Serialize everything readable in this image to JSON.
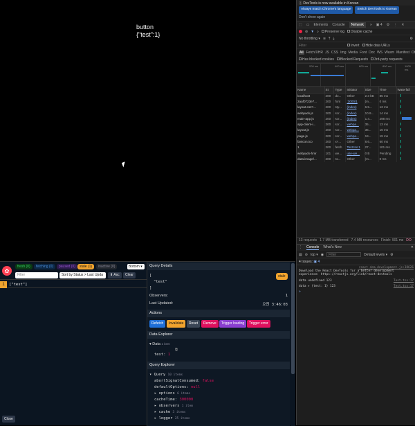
{
  "app": {
    "button_text": "button",
    "json_text": "{\"test\":1}"
  },
  "devtools": {
    "info_bar": "DevTools is now available in Korean",
    "btn_match_language": "Always match Chrome's language",
    "btn_switch_korean": "Switch DevTools to Korean",
    "dont_show": "Don't show again",
    "tabs": [
      "Elements",
      "Console",
      "Network"
    ],
    "active_tab": "Network",
    "issues_count_tab": "4",
    "preserve_log": "Preserve log",
    "disable_cache": "Disable cache",
    "throttling": "No throttling",
    "filter_placeholder": "Filter",
    "invert": "Invert",
    "hide_data_urls": "Hide data URLs",
    "type_filters": [
      "All",
      "Fetch/XHR",
      "JS",
      "CSS",
      "Img",
      "Media",
      "Font",
      "Doc",
      "WS",
      "Wasm",
      "Manifest",
      "Oth"
    ],
    "has_blocked_cookies": "Has blocked cookies",
    "blocked_requests": "Blocked Requests",
    "third_party": "3rd-party requests",
    "timeline_ticks": [
      "200 ms",
      "400 ms",
      "600 ms",
      "800 ms",
      "1000 ms"
    ],
    "columns": [
      "Name",
      "St",
      "Type",
      "Initiator",
      "Size",
      "Time",
      "Waterfall"
    ],
    "requests": [
      {
        "name": "localhost",
        "st": "200",
        "type": "do...",
        "init": "Other",
        "size": "2.3 kB",
        "time": "85 ms"
      },
      {
        "name": "2aaf0723e7...",
        "st": "200",
        "type": "font",
        "init": ":3000/1",
        "size": "(m...",
        "time": "0 ms"
      },
      {
        "name": "layout.css?...",
        "st": "200",
        "type": "sty...",
        "init": "(index)",
        "size": "6.5...",
        "time": "13 ms"
      },
      {
        "name": "webpack.js",
        "st": "200",
        "type": "scr...",
        "init": "(index)",
        "size": "10.9...",
        "time": "14 ms"
      },
      {
        "name": "main-app.js",
        "st": "200",
        "type": "scr...",
        "init": "(index)",
        "size": "1.4...",
        "time": "298 ms"
      },
      {
        "name": "app-client-i...",
        "st": "200",
        "type": "scr...",
        "init": "webpa...",
        "size": "35...",
        "time": "13 ms"
      },
      {
        "name": "layout.js",
        "st": "200",
        "type": "scr...",
        "init": "webpa...",
        "size": "36...",
        "time": "16 ms"
      },
      {
        "name": "page.js",
        "st": "200",
        "type": "scr...",
        "init": "webpa...",
        "size": "19...",
        "time": "19 ms"
      },
      {
        "name": "favicon.ico",
        "st": "200",
        "type": "x-i...",
        "init": "Other",
        "size": "8.6...",
        "time": "60 ms"
      },
      {
        "name": "1",
        "st": "200",
        "type": "fetch",
        "init": "Test.tsx:1",
        "size": "27...",
        "time": "101 ms"
      },
      {
        "name": "webpack-hmr",
        "st": "101",
        "type": "we...",
        "init": "use-we...",
        "size": "0 B",
        "time": "Pending"
      },
      {
        "name": "data:image/...",
        "st": "200",
        "type": "sv...",
        "init": "Other",
        "size": "(m...",
        "time": "0 ms"
      }
    ],
    "status_requests": "13 requests",
    "status_transferred": "1.7 MB transferred",
    "status_resources": "7.4 MB resources",
    "status_finish": "Finish: 901 ms",
    "status_more": "DO",
    "console_tabs": [
      "Console",
      "What's New"
    ],
    "console_context": "top",
    "console_filter": "Filter",
    "default_levels": "Default levels",
    "issues_label": "4 Issues:",
    "issues_count": "4",
    "log_src_react": "react-dom.development.js:38626",
    "log_react_msg_1": "Download the React DevTools for a better development",
    "log_react_msg_2": "experience: https://reactjs.org/link/react-devtools",
    "log_data_undefined": "data undefined 123",
    "log_src_test": "Test.tsx:17",
    "log_data_obj": "data ▸ {test: 1} 123",
    "log_src_test2": "Test.tsx:17",
    "prompt": ">"
  },
  "rq": {
    "pills": {
      "fresh": "fresh (0)",
      "fetching": "fetching (0)",
      "paused": "paused (0)",
      "stale": "stale (1)",
      "inactive": "inactive (0)"
    },
    "position": "Bottom",
    "filter_placeholder": "Filter",
    "sort": "Sort by Status > Last Upda",
    "asc": "⬆ Asc",
    "clear": "Clear",
    "query_count": "1",
    "query_key": "[\"test\"]",
    "close": "Close",
    "details_title": "Query Details",
    "key_lines": [
      "[",
      "\"test\"",
      "]"
    ],
    "stale_badge": "stale",
    "observers_label": "Observers:",
    "observers_value": "1",
    "last_updated_label": "Last Updated:",
    "last_updated_value": "오전 3:46:03",
    "actions_title": "Actions",
    "actions": [
      "Refetch",
      "Invalidate",
      "Reset",
      "Remove",
      "Trigger loading",
      "Trigger error"
    ],
    "data_explorer_title": "Data Explorer",
    "data_label": "▾ Data",
    "data_count": "1 item",
    "data_key": "test:",
    "data_value": "1",
    "query_explorer_title": "Query Explorer",
    "query_label": "▾ Query",
    "query_count_items": "10 items",
    "q_abort_key": "abortSignalConsumed:",
    "q_abort_val": "false",
    "q_default_key": "defaultOptions:",
    "q_default_val": "null",
    "q_options": "▸ options",
    "q_options_count": "6 items",
    "q_cache_key": "cacheTime:",
    "q_cache_val": "300000",
    "q_observers": "▸ observers",
    "q_observers_count": "1 item",
    "q_cache": "▸ cache",
    "q_cache_count": "3 items",
    "q_logger": "▸ logger",
    "q_logger_count": "25 items"
  },
  "colors": {
    "stale": "#f0a32e",
    "refetch": "#1e6fd9",
    "invalidate": "#f0a32e",
    "reset": "#3a4656",
    "remove": "#e0115f",
    "trigger_loading": "#8a3fd1",
    "trigger_error": "#e0115f"
  }
}
